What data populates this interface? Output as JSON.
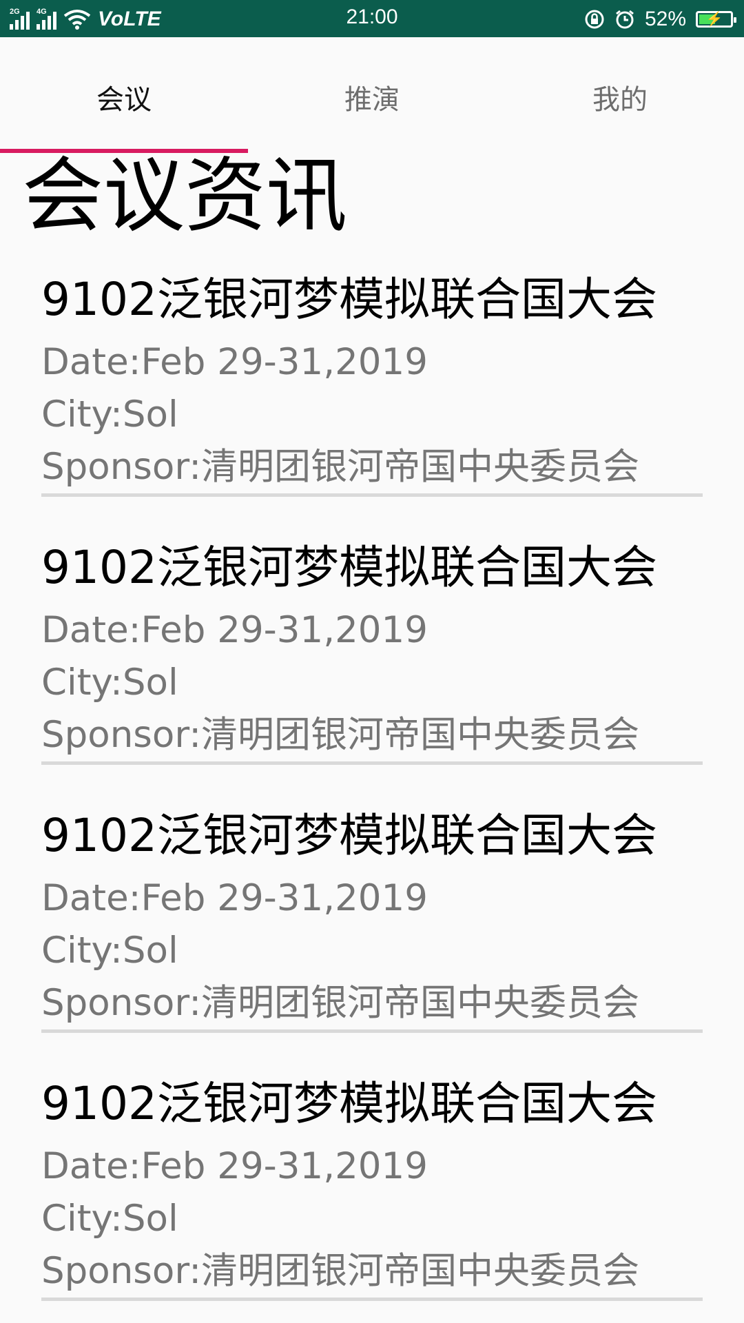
{
  "status_bar": {
    "signal1_tag": "2G",
    "signal2_tag": "4G",
    "network": "VoLTE",
    "time": "21:00",
    "battery_percent": "52%",
    "battery_level": 0.52,
    "icons": [
      "signal-icon",
      "signal-icon",
      "wifi-icon",
      "lock-rotation-icon",
      "alarm-icon",
      "battery-charging-icon"
    ]
  },
  "tabs": [
    {
      "label": "会议",
      "active": true
    },
    {
      "label": "推演",
      "active": false
    },
    {
      "label": "我的",
      "active": false
    }
  ],
  "accent_color": "#d81b60",
  "status_bar_color": "#0b5d4d",
  "section_title": "会议资讯",
  "conferences": [
    {
      "title": "9102泛银河梦模拟联合国大会",
      "date": "Date:Feb 29-31,2019",
      "city": "City:Sol",
      "sponsor": "Sponsor:清明团银河帝国中央委员会"
    },
    {
      "title": "9102泛银河梦模拟联合国大会",
      "date": "Date:Feb 29-31,2019",
      "city": "City:Sol",
      "sponsor": "Sponsor:清明团银河帝国中央委员会"
    },
    {
      "title": "9102泛银河梦模拟联合国大会",
      "date": "Date:Feb 29-31,2019",
      "city": "City:Sol",
      "sponsor": "Sponsor:清明团银河帝国中央委员会"
    },
    {
      "title": "9102泛银河梦模拟联合国大会",
      "date": "Date:Feb 29-31,2019",
      "city": "City:Sol",
      "sponsor": "Sponsor:清明团银河帝国中央委员会"
    }
  ]
}
